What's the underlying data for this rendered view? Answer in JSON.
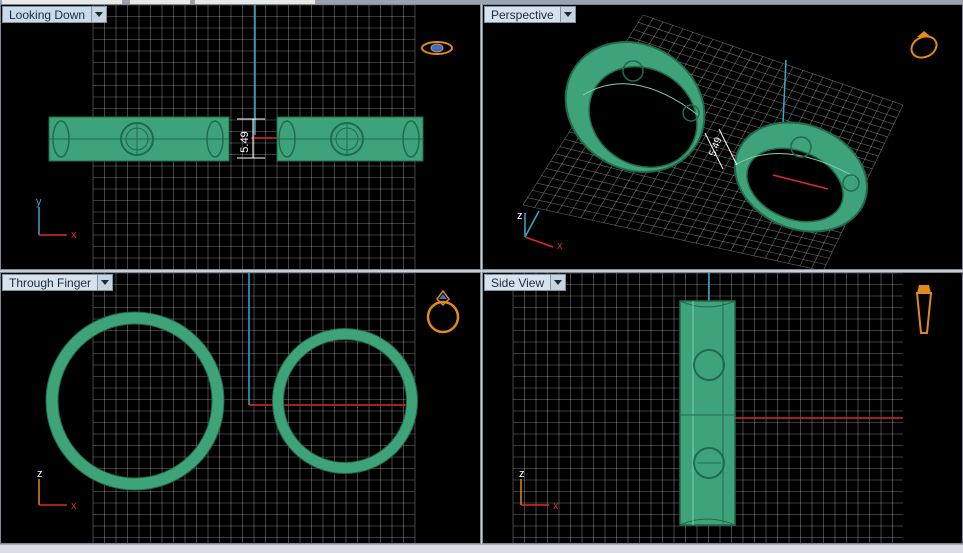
{
  "colors": {
    "ring_fill": "#3fa37a",
    "ring_edge": "#1f6b4c",
    "ring_highlight": "#7fd1ae",
    "grid": "#ffffff",
    "axis_x": "#d92b2b",
    "axis_y": "#3aa8c8",
    "viewport_bg": "#000000",
    "icon": "#e08a1c"
  },
  "viewports": [
    {
      "id": "looking-down",
      "label": "Looking Down",
      "icon": "ring-top-icon",
      "axes": {
        "vertical": "y",
        "horizontal": "x"
      },
      "dimension": "5.49"
    },
    {
      "id": "perspective",
      "label": "Perspective",
      "icon": "ring-perspective-icon",
      "axes": {
        "vertical": "z",
        "horizontal": "x"
      },
      "dimension": "5.49"
    },
    {
      "id": "through-finger",
      "label": "Through Finger",
      "icon": "ring-front-icon",
      "axes": {
        "vertical": "z",
        "horizontal": "x"
      }
    },
    {
      "id": "side-view",
      "label": "Side View",
      "icon": "ring-side-icon",
      "axes": {
        "vertical": "z",
        "horizontal": "x"
      }
    }
  ]
}
